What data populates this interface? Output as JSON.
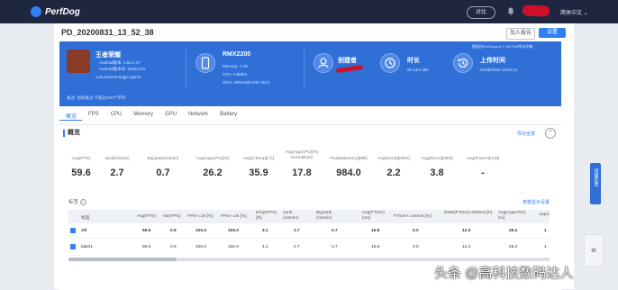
{
  "app": {
    "brand": "PerfDog",
    "compare": "对比",
    "language": "简体中文"
  },
  "session": {
    "title": "PD_20200831_13_52_38",
    "report_btn": "加入报告",
    "settings_btn": "设置",
    "app_name": "王者荣耀",
    "app_version": "Android版本: 1.54.1.37",
    "app_build": "Android版本号: 54011701",
    "package": "com.tencent.tmgp.sgame",
    "device_name": "RMX2200",
    "memory": "Memory: 7.4G",
    "cpu": "CPU: mt6853",
    "gpu": "GPU: ARM Mali-G57 MC3",
    "creator_label": "创建者",
    "duration_label": "时长",
    "duration_value": "0h 14m 39s",
    "upload_label": "上传时间",
    "upload_value": "31/08/2020 13:52:41",
    "version_note": "数据由PerfDog(v4.1.200708)版本收集",
    "remark": "备注: 添加备注   不超过200个字符"
  },
  "tabs": [
    "概览",
    "FPS",
    "CPU",
    "Memory",
    "GPU",
    "Network",
    "Battery"
  ],
  "overview": {
    "heading": "概览",
    "export": "导出全部",
    "collapse_icon": "chevron-up-icon",
    "metrics": [
      {
        "label": "Avg(FPS)",
        "value": "59.6"
      },
      {
        "label": "Jank(/10min)",
        "value": "2.7"
      },
      {
        "label": "BigJank(/10min)",
        "value": "0.7"
      },
      {
        "label": "Avg(AppCPU)[%]",
        "value": "26.2"
      },
      {
        "label": "Avg(CTemp)[°C]",
        "value": "35.9"
      },
      {
        "label": "Avg(AppCPU)[%] Normalized",
        "value": "17.8"
      },
      {
        "label": "Peak(Memory)[MB]",
        "value": "984.0"
      },
      {
        "label": "Avg(Send)[KB/s]",
        "value": "2.2"
      },
      {
        "label": "Avg(Recv)[KB/s]",
        "value": "3.8"
      },
      {
        "label": "Avg(Power)[mW]",
        "value": "-"
      }
    ]
  },
  "tags": {
    "label": "标签",
    "custom": "参数显示设置",
    "columns": [
      "标签",
      "Avg(FPS)",
      "Var(FPS)",
      "FPS>=18 [%]",
      "FPS>=25 [%]",
      "Drop(FPS) [/h]",
      "Jank (/10min)",
      "BigJank (/10min)",
      "Avg(FTime) [ms]",
      "FTime>=100ms [%]",
      "Delta(FTime)>100ms [/h]",
      "Avg(AppCPU) [%]",
      "AppC"
    ],
    "rows": [
      [
        "All",
        "59.6",
        "0.9",
        "100.0",
        "100.0",
        "4.1",
        "2.7",
        "0.7",
        "16.8",
        "0.0",
        "12.3",
        "26.2",
        "1"
      ],
      [
        "label1",
        "56.6",
        "0.9",
        "100.0",
        "100.0",
        "4.1",
        "2.7",
        "0.7",
        "16.8",
        "0.0",
        "12.3",
        "26.2",
        "1"
      ]
    ]
  },
  "side": {
    "feedback": "问题反馈",
    "collapse": "«"
  },
  "watermark": "头条 @高科技数码达人",
  "colors": {
    "accent": "#2f7ff7",
    "banner": "#2f6fd6",
    "topbar": "#1f2740"
  }
}
